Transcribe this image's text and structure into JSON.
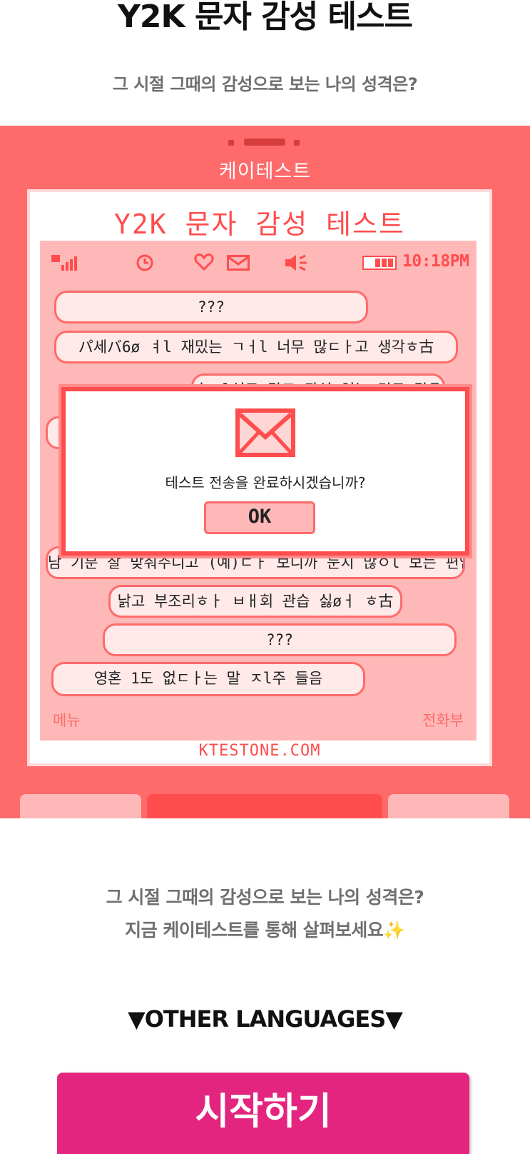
{
  "header": {
    "title": "Y2K 문자 감성 테스트",
    "subtitle": "그 시절 그때의 감성으로 보는 나의 성격은?"
  },
  "phone": {
    "brand": "케이테스트",
    "title": "Y2K 문자 감성 테스트",
    "time": "10:18PM",
    "status_icons": [
      "signal-icon",
      "clock-icon",
      "heart-icon",
      "mail-icon",
      "speaker-icon",
      "battery-icon"
    ],
    "messages": [
      "???",
      "パ세バ6ø ㅕl 재밌는 ㄱㅓl 너무 많ㄷㅏ고 생각ㅎ古",
      "호ㄱl심도 많고 관심 있는 것도 많음",
      "",
      "",
      "남 기분 잘 맞춰주니고 (예)ㄷㅏ 보니까 눈치 많ㅇl 보는 편임",
      "낡고 부조리ㅎㅏ ㅂㅐ회 관습 싫øㅓ ㅎ古",
      "???",
      "영혼 1도 없ㄷㅏ는 말 ㅈl주 들음"
    ],
    "dialog": {
      "message": "테스트 전송을 완료하시겠습니까?",
      "ok_label": "OK"
    },
    "softkey_left": "메뉴",
    "softkey_right": "전화부",
    "site": "KTESTONE.COM"
  },
  "body": {
    "line1": "그 시절 그때의 감성으로 보는 나의 성격은?",
    "line2": "지금 케이테스트를 통해 살펴보세요",
    "sparkle": "✨",
    "languages_label": "▼OTHER LANGUAGES▼",
    "start_label": "시작하기"
  },
  "colors": {
    "hero_bg": "#ff6a6a",
    "accent": "#ff4d4d",
    "screen_bg": "#ffb8b8",
    "start_button": "#e3257f"
  }
}
